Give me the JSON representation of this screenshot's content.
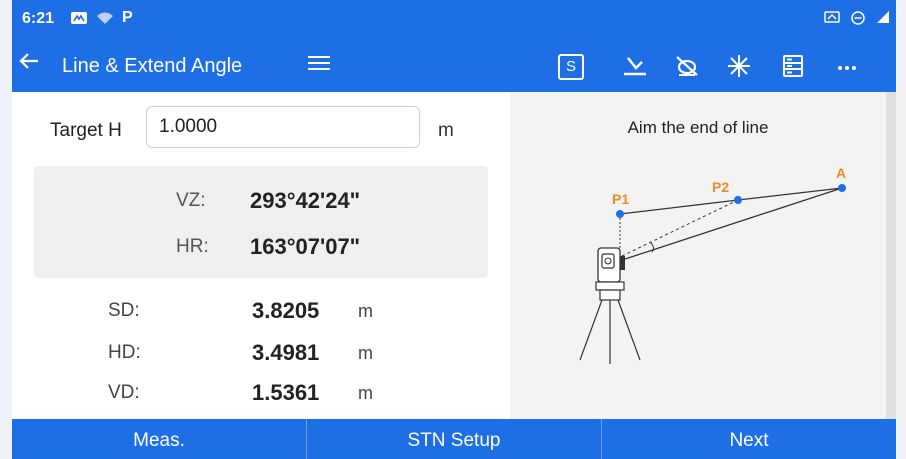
{
  "status_bar": {
    "time": "6:21",
    "icons_left": [
      "cloud-icon",
      "wifi-icon",
      "p-app-icon"
    ],
    "icons_right": [
      "signal-icon",
      "minus-circle-icon",
      "cell-icon"
    ]
  },
  "app_bar": {
    "title": "Line & Extend Angle",
    "s_label": "S",
    "icons": [
      "back-arrow-icon",
      "menu-icon",
      "s-box-icon",
      "prism-icon",
      "no-laser-icon",
      "laser-star-icon",
      "list-icon",
      "more-icon"
    ]
  },
  "target": {
    "label": "Target H",
    "value": "1.0000",
    "unit": "m"
  },
  "angles": {
    "vz_label": "VZ:",
    "vz_value": "293°42'24\"",
    "hr_label": "HR:",
    "hr_value": "163°07'07\""
  },
  "measurements": {
    "sd_label": "SD:",
    "sd_value": "3.8205",
    "hd_label": "HD:",
    "hd_value": "3.4981",
    "vd_label": "VD:",
    "vd_value": "1.5361",
    "unit": "m"
  },
  "diagram": {
    "caption": "Aim the end of line",
    "p1": "P1",
    "p2": "P2",
    "a": "A",
    "point_color": "#1e6ee6",
    "label_color": "#f08a24"
  },
  "bottom": {
    "meas": "Meas.",
    "stn_setup": "STN Setup",
    "next": "Next"
  },
  "colors": {
    "primary": "#1e6ee6",
    "panel_gray": "#efefef"
  }
}
